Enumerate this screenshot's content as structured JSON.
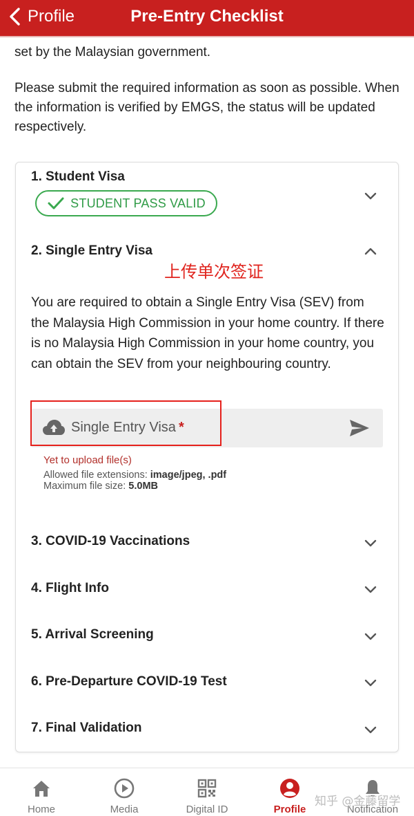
{
  "header": {
    "back_label": "Profile",
    "title": "Pre-Entry Checklist"
  },
  "intro": {
    "paragraph1": "set by the Malaysian government.",
    "paragraph2": "Please submit the required information as soon as possible. When the information is verified by EMGS, the status will be updated respectively."
  },
  "checklist": {
    "items": [
      {
        "title": "1. Student Visa",
        "status": "STUDENT PASS VALID",
        "expanded": false
      },
      {
        "title": "2. Single Entry Visa",
        "expanded": true
      },
      {
        "title": "3. COVID-19 Vaccinations",
        "expanded": false
      },
      {
        "title": "4. Flight Info",
        "expanded": false
      },
      {
        "title": "5. Arrival Screening",
        "expanded": false
      },
      {
        "title": "6. Pre-Departure COVID-19 Test",
        "expanded": false
      },
      {
        "title": "7. Final Validation",
        "expanded": false
      }
    ],
    "sev": {
      "annotation": "上传单次签证",
      "description": "You are required to obtain a Single Entry Visa (SEV) from the Malaysia High Commission in your home country. If there is no Malaysia High Commission in your home country, you can obtain the SEV from your neighbouring country.",
      "upload_label": "Single Entry Visa",
      "required_mark": "*",
      "upload_status": "Yet to upload file(s)",
      "allowed_prefix": "Allowed file extensions: ",
      "allowed_value": "image/jpeg, .pdf",
      "max_prefix": "Maximum file size: ",
      "max_value": "5.0MB"
    }
  },
  "tabs": [
    {
      "label": "Home",
      "icon": "home-icon",
      "active": false
    },
    {
      "label": "Media",
      "icon": "play-icon",
      "active": false
    },
    {
      "label": "Digital ID",
      "icon": "qr-code-icon",
      "active": false
    },
    {
      "label": "Profile",
      "icon": "user-icon",
      "active": true
    },
    {
      "label": "Notification",
      "icon": "bell-icon",
      "active": false
    }
  ],
  "watermark": "知乎 @金藤留学",
  "colors": {
    "brand_red": "#c8201f",
    "status_green": "#3aa94f",
    "annotation_red": "#e5201b"
  }
}
